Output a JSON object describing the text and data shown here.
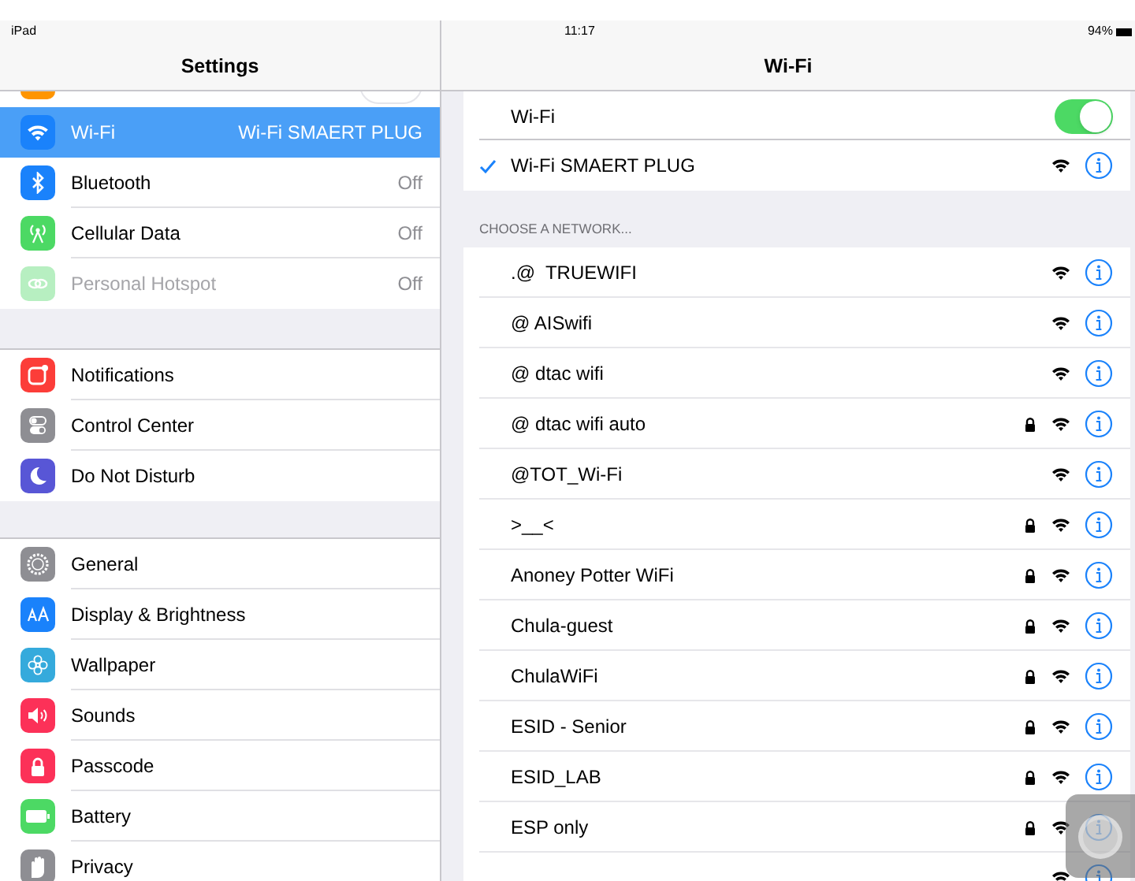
{
  "status_bar": {
    "device": "iPad",
    "time": "11:17",
    "battery": "94%"
  },
  "sidebar": {
    "title": "Settings",
    "top_toggle_on": false,
    "groups": [
      [
        {
          "label": "Wi-Fi",
          "value": "Wi-Fi SMAERT PLUG",
          "color": "#1a82fb",
          "selected": true,
          "disabled": false
        },
        {
          "label": "Bluetooth",
          "value": "Off",
          "color": "#1a82fb",
          "selected": false,
          "disabled": false
        },
        {
          "label": "Cellular Data",
          "value": "Off",
          "color": "#4cd964",
          "selected": false,
          "disabled": false
        },
        {
          "label": "Personal Hotspot",
          "value": "Off",
          "color": "#b7efc1",
          "selected": false,
          "disabled": true
        }
      ],
      [
        {
          "label": "Notifications",
          "color": "#fc3d39",
          "selected": false,
          "disabled": false
        },
        {
          "label": "Control Center",
          "color": "#8e8e93",
          "selected": false,
          "disabled": false
        },
        {
          "label": "Do Not Disturb",
          "color": "#5856d6",
          "selected": false,
          "disabled": false
        }
      ],
      [
        {
          "label": "General",
          "color": "#8e8e93",
          "selected": false,
          "disabled": false
        },
        {
          "label": "Display & Brightness",
          "color": "#1a82fb",
          "selected": false,
          "disabled": false
        },
        {
          "label": "Wallpaper",
          "color": "#35aadc",
          "selected": false,
          "disabled": false
        },
        {
          "label": "Sounds",
          "color": "#fc3158",
          "selected": false,
          "disabled": false
        },
        {
          "label": "Passcode",
          "color": "#fc3158",
          "selected": false,
          "disabled": false
        },
        {
          "label": "Battery",
          "color": "#4cd964",
          "selected": false,
          "disabled": false
        },
        {
          "label": "Privacy",
          "color": "#8e8e93",
          "selected": false,
          "disabled": false
        }
      ]
    ]
  },
  "detail": {
    "title": "Wi-Fi",
    "wifi_label": "Wi-Fi",
    "wifi_on": true,
    "connected": {
      "name": "Wi-Fi SMAERT PLUG",
      "checked": true,
      "secured": false
    },
    "section_header": "CHOOSE A NETWORK...",
    "networks": [
      {
        "name": ".@  TRUEWIFI",
        "secured": false
      },
      {
        "name": "@ AISwifi",
        "secured": false
      },
      {
        "name": "@ dtac wifi",
        "secured": false
      },
      {
        "name": "@ dtac wifi auto",
        "secured": true
      },
      {
        "name": "@TOT_Wi-Fi",
        "secured": false
      },
      {
        "name": ">__<",
        "secured": true
      },
      {
        "name": "Anoney Potter WiFi",
        "secured": true
      },
      {
        "name": "Chula-guest",
        "secured": true
      },
      {
        "name": "ChulaWiFi",
        "secured": true
      },
      {
        "name": "ESID - Senior",
        "secured": true
      },
      {
        "name": "ESID_LAB",
        "secured": true
      },
      {
        "name": "ESP only",
        "secured": true
      },
      {
        "secured": false
      }
    ]
  }
}
